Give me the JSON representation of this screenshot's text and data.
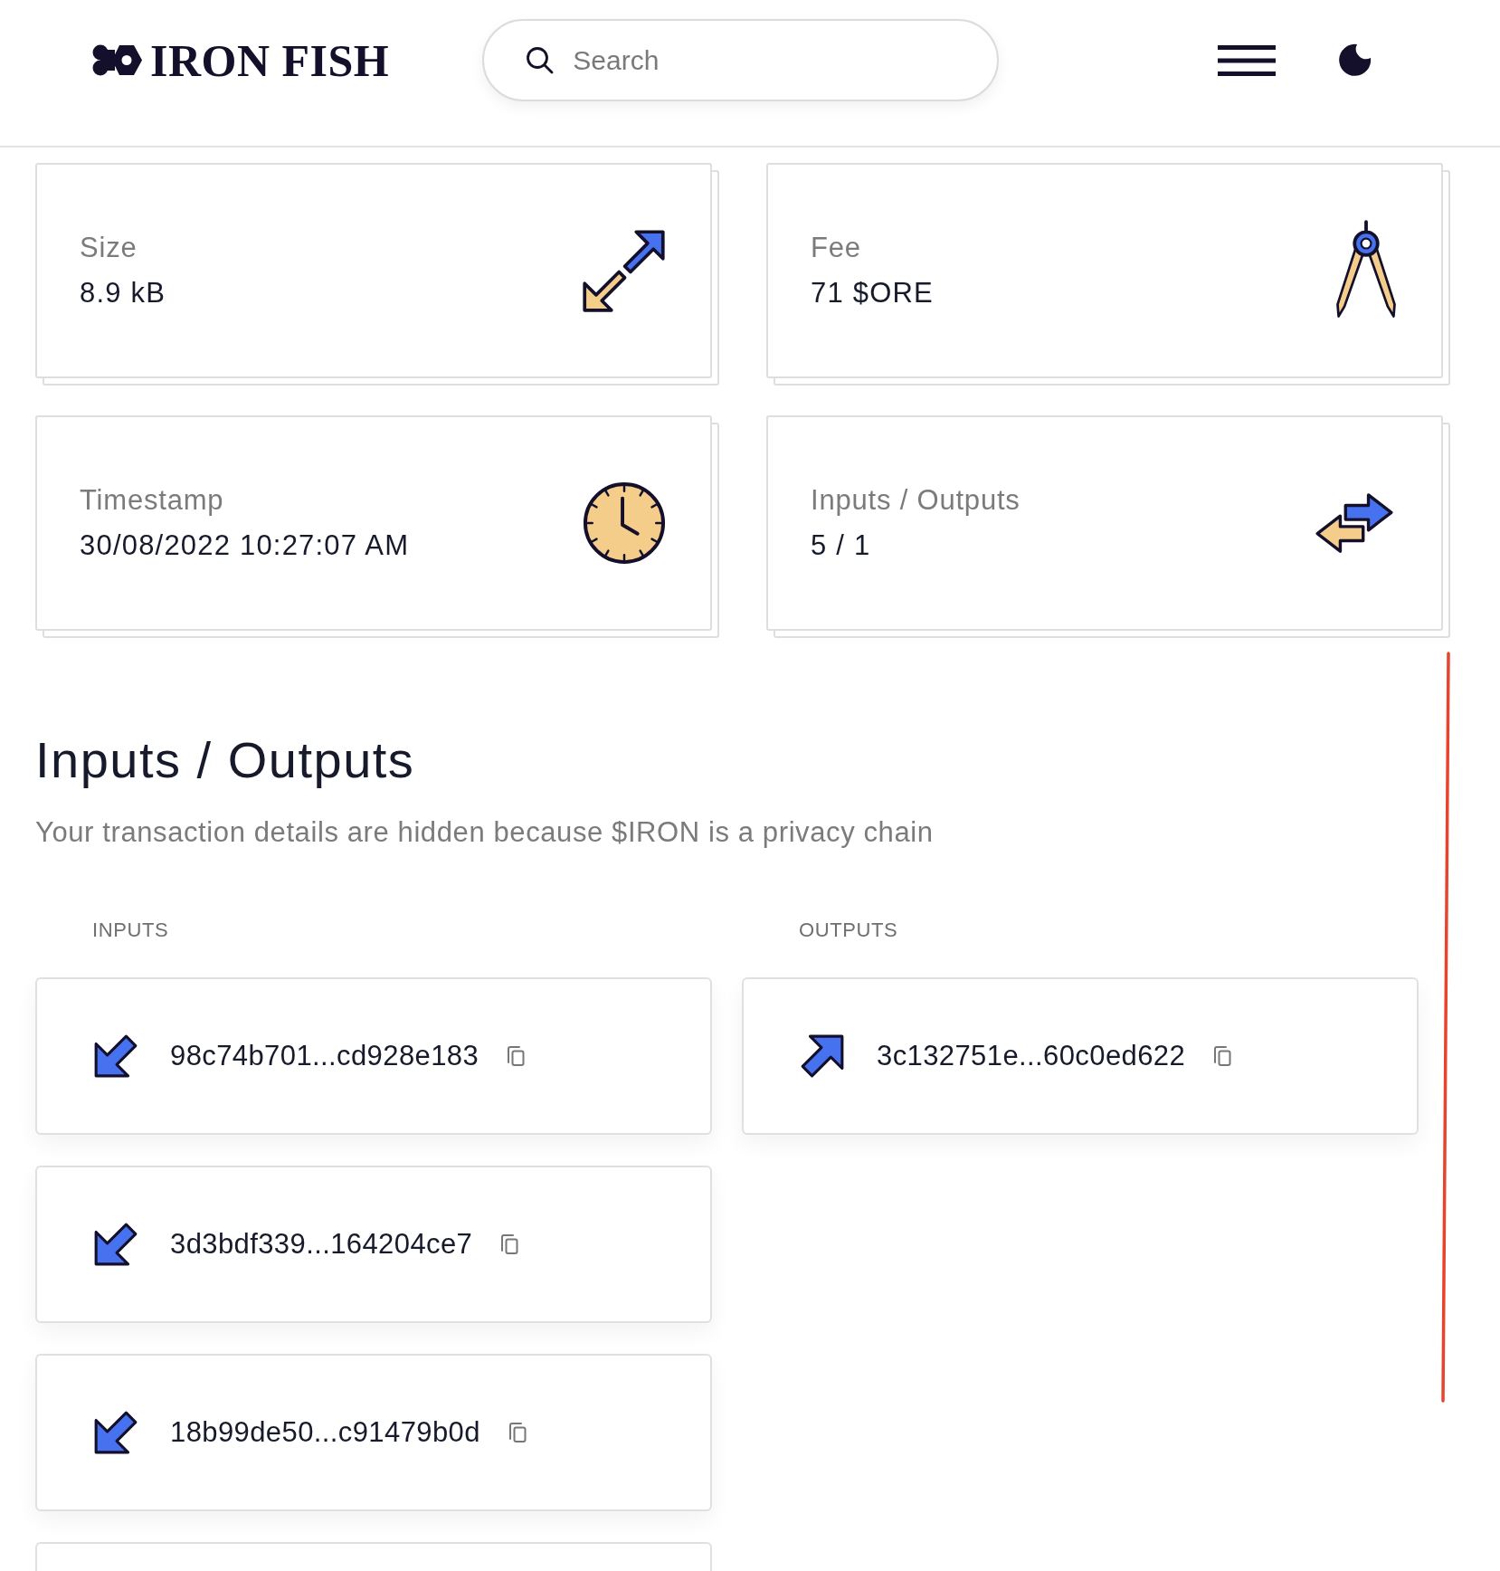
{
  "header": {
    "brand": "IRON FISH",
    "search": {
      "placeholder": "Search"
    }
  },
  "stats": [
    {
      "kind": "size",
      "label": "Size",
      "value": "8.9 kB"
    },
    {
      "kind": "fee",
      "label": "Fee",
      "value": "71 $ORE"
    },
    {
      "kind": "timestamp",
      "label": "Timestamp",
      "value": "30/08/2022 10:27:07 AM"
    },
    {
      "kind": "inputs_outputs",
      "label": "Inputs / Outputs",
      "value": "5 / 1"
    }
  ],
  "io_section": {
    "title": "Inputs / Outputs",
    "description": "Your transaction details are hidden because $IRON is a privacy chain",
    "inputs": {
      "heading": "INPUTS",
      "items": [
        {
          "hash": "98c74b701...cd928e183"
        },
        {
          "hash": "3d3bdf339...164204ce7"
        },
        {
          "hash": "18b99de50...c91479b0d"
        }
      ],
      "more_below": true
    },
    "outputs": {
      "heading": "OUTPUTS",
      "items": [
        {
          "hash": "3c132751e...60c0ed622"
        }
      ]
    }
  }
}
